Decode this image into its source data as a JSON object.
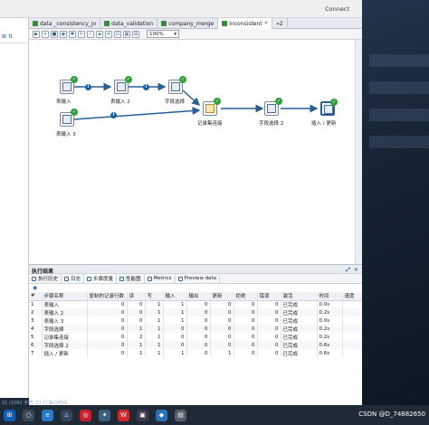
{
  "topbar": {
    "connect_label": "Connect"
  },
  "tabs": [
    {
      "label": "data _consistency_jo"
    },
    {
      "label": "data_validation"
    },
    {
      "label": "company_merge"
    },
    {
      "label": "inconsistent"
    },
    {
      "label": "»2"
    }
  ],
  "toolbar": {
    "zoom": "100%"
  },
  "steps": [
    {
      "label": "表输入"
    },
    {
      "label": "表输入 2"
    },
    {
      "label": "字段选择"
    },
    {
      "label": "表输入 3"
    },
    {
      "label": "记录集连接"
    },
    {
      "label": "字段选择 2"
    },
    {
      "label": "插入 / 更新"
    }
  ],
  "results": {
    "title": "执行结果",
    "tabs": [
      "执行历史",
      "日志",
      "步骤度量",
      "性能图",
      "Metrics",
      "Preview data"
    ],
    "columns": [
      "#",
      "步骤名称",
      "复制的记录行数",
      "读",
      "写",
      "输入",
      "输出",
      "更新",
      "拒绝",
      "错误",
      "激活",
      "时间",
      "速度"
    ],
    "rows": [
      [
        "1",
        "表输入",
        "0",
        "0",
        "1",
        "1",
        "0",
        "0",
        "0",
        "0",
        "已完成",
        "0.0s",
        ""
      ],
      [
        "2",
        "表输入 2",
        "0",
        "0",
        "1",
        "1",
        "0",
        "0",
        "0",
        "0",
        "已完成",
        "0.2s",
        ""
      ],
      [
        "3",
        "表输入 3",
        "0",
        "0",
        "1",
        "1",
        "0",
        "0",
        "0",
        "0",
        "已完成",
        "0.0s",
        ""
      ],
      [
        "4",
        "字段选择",
        "0",
        "1",
        "1",
        "0",
        "0",
        "0",
        "0",
        "0",
        "已完成",
        "0.2s",
        ""
      ],
      [
        "5",
        "记录集连接",
        "0",
        "2",
        "1",
        "0",
        "0",
        "0",
        "0",
        "0",
        "已完成",
        "0.2s",
        ""
      ],
      [
        "6",
        "字段选择 2",
        "0",
        "1",
        "1",
        "0",
        "0",
        "0",
        "0",
        "0",
        "已完成",
        "0.6s",
        ""
      ],
      [
        "7",
        "插入 / 更新",
        "0",
        "1",
        "1",
        "1",
        "0",
        "1",
        "0",
        "0",
        "已完成",
        "0.6s",
        ""
      ]
    ]
  },
  "desktop": {
    "overlay_text": "11 (1092 字符, 11 行 执行时间"
  },
  "tray": {
    "text": "CSDN @D_74882650"
  }
}
